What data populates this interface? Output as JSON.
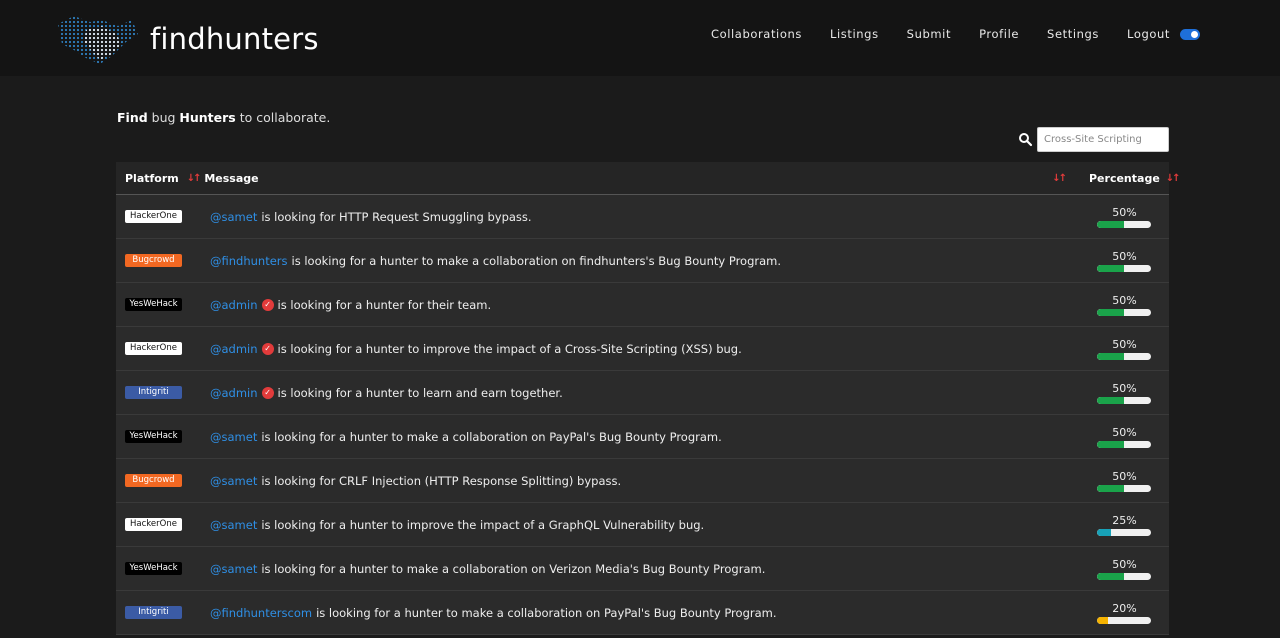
{
  "brand": {
    "name": "findhunters"
  },
  "nav": [
    {
      "label": "Collaborations"
    },
    {
      "label": "Listings"
    },
    {
      "label": "Submit"
    },
    {
      "label": "Profile"
    },
    {
      "label": "Settings"
    },
    {
      "label": "Logout"
    }
  ],
  "intro": {
    "w1": "Find",
    "w2": " bug ",
    "w3": "Hunters",
    "w4": " to collaborate."
  },
  "search": {
    "placeholder": "Cross-Site Scripting",
    "icon": "search-icon"
  },
  "table": {
    "headers": {
      "platform": "Platform",
      "message": "Message",
      "percentage": "Percentage"
    },
    "rows": [
      {
        "platform": "HackerOne",
        "user": "@samet",
        "verified": false,
        "text": "is looking for HTTP Request Smuggling bypass.",
        "percent_label": "50%",
        "percent": 50
      },
      {
        "platform": "Bugcrowd",
        "user": "@findhunters",
        "verified": false,
        "text": "is looking for a hunter to make a collaboration on findhunters's Bug Bounty Program.",
        "percent_label": "50%",
        "percent": 50
      },
      {
        "platform": "YesWeHack",
        "user": "@admin",
        "verified": true,
        "text": "is looking for a hunter for their team.",
        "percent_label": "50%",
        "percent": 50
      },
      {
        "platform": "HackerOne",
        "user": "@admin",
        "verified": true,
        "text": "is looking for a hunter to improve the impact of a Cross-Site Scripting (XSS) bug.",
        "percent_label": "50%",
        "percent": 50
      },
      {
        "platform": "Intigriti",
        "user": "@admin",
        "verified": true,
        "text": "is looking for a hunter to learn and earn together.",
        "percent_label": "50%",
        "percent": 50
      },
      {
        "platform": "YesWeHack",
        "user": "@samet",
        "verified": false,
        "text": "is looking for a hunter to make a collaboration on PayPal's Bug Bounty Program.",
        "percent_label": "50%",
        "percent": 50
      },
      {
        "platform": "Bugcrowd",
        "user": "@samet",
        "verified": false,
        "text": "is looking for CRLF Injection (HTTP Response Splitting) bypass.",
        "percent_label": "50%",
        "percent": 50
      },
      {
        "platform": "HackerOne",
        "user": "@samet",
        "verified": false,
        "text": "is looking for a hunter to improve the impact of a GraphQL Vulnerability bug.",
        "percent_label": "25%",
        "percent": 25
      },
      {
        "platform": "YesWeHack",
        "user": "@samet",
        "verified": false,
        "text": "is looking for a hunter to make a collaboration on Verizon Media's Bug Bounty Program.",
        "percent_label": "50%",
        "percent": 50
      },
      {
        "platform": "Intigriti",
        "user": "@findhunterscom",
        "verified": false,
        "text": "is looking for a hunter to make a collaboration on PayPal's Bug Bounty Program.",
        "percent_label": "20%",
        "percent": 20
      }
    ]
  },
  "colors": {
    "HackerOne": {
      "bg": "#ffffff",
      "fg": "#111111"
    },
    "Bugcrowd": {
      "bg": "#f26822",
      "fg": "#ffffff"
    },
    "YesWeHack": {
      "bg": "#000000",
      "fg": "#ffffff"
    },
    "Intigriti": {
      "bg": "#3b5ba5",
      "fg": "#ffffff"
    },
    "bar_50": "#1aa34a",
    "bar_25": "#17a2b8",
    "bar_20": "#f5b301",
    "link": "#2f8fe5",
    "sort_arrows": "#e23b3b"
  }
}
